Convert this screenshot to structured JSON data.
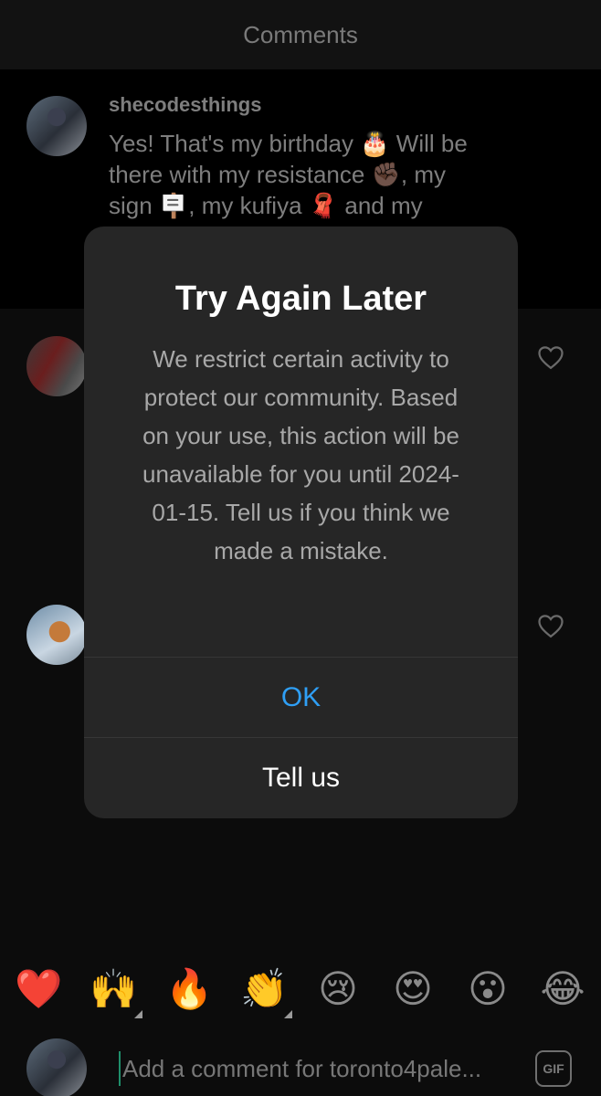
{
  "header": {
    "title": "Comments"
  },
  "comment": {
    "username": "shecodesthings",
    "text": "Yes! That's my birthday 🎂 Will be there with my resistance ✊🏿, my sign 🪧, my kufiya 🧣 and my"
  },
  "dialog": {
    "title": "Try Again Later",
    "body": "We restrict certain activity to protect our community. Based on your use, this action will be unavailable for you until 2024-01-15. Tell us if you think we made a mistake.",
    "ok_label": "OK",
    "tell_us_label": "Tell us"
  },
  "emoji_bar": [
    {
      "name": "red-heart",
      "glyph": "❤️"
    },
    {
      "name": "raising-hands",
      "glyph": "🙌"
    },
    {
      "name": "fire",
      "glyph": "🔥"
    },
    {
      "name": "clapping-hands",
      "glyph": "👏"
    },
    {
      "name": "crying-face",
      "glyph": "😢"
    },
    {
      "name": "heart-eyes",
      "glyph": "😍"
    },
    {
      "name": "surprised-face",
      "glyph": "😮"
    },
    {
      "name": "tears-of-joy",
      "glyph": "😂"
    }
  ],
  "input": {
    "placeholder": "Add a comment for toronto4pale...",
    "gif_label": "GIF"
  },
  "colors": {
    "accent_blue": "#2f9ff5",
    "dialog_bg": "#262626",
    "page_bg": "#000000"
  }
}
